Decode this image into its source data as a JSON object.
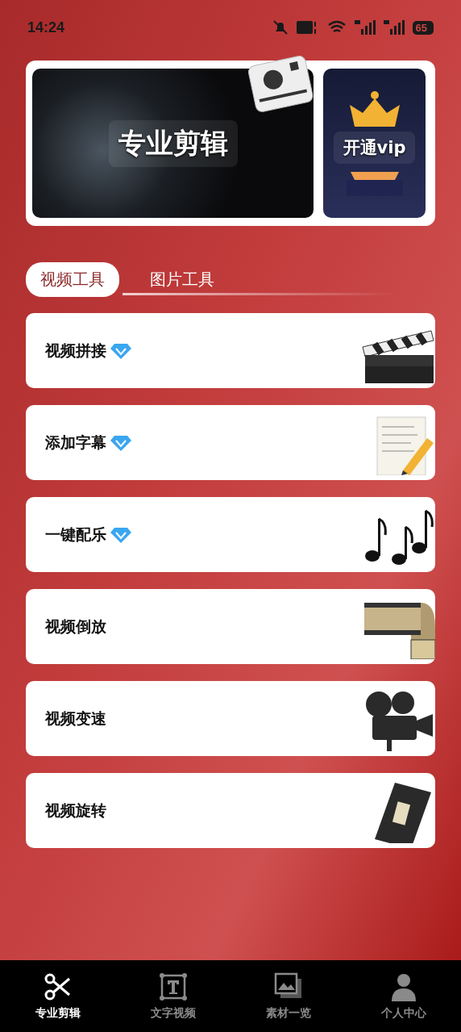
{
  "status_bar": {
    "time": "14:24",
    "battery": "65"
  },
  "banner": {
    "main_label": "专业剪辑",
    "vip_label": "开通vip"
  },
  "tabs": [
    {
      "label": "视频工具",
      "selected": true
    },
    {
      "label": "图片工具",
      "selected": false
    }
  ],
  "tools": [
    {
      "label": "视频拼接",
      "vip": true
    },
    {
      "label": "添加字幕",
      "vip": true
    },
    {
      "label": "一键配乐",
      "vip": true
    },
    {
      "label": "视频倒放",
      "vip": false
    },
    {
      "label": "视频变速",
      "vip": false
    },
    {
      "label": "视频旋转",
      "vip": false
    }
  ],
  "bottom_nav": [
    {
      "label": "专业剪辑",
      "selected": true
    },
    {
      "label": "文字视频",
      "selected": false
    },
    {
      "label": "素材一览",
      "selected": false
    },
    {
      "label": "个人中心",
      "selected": false
    }
  ]
}
